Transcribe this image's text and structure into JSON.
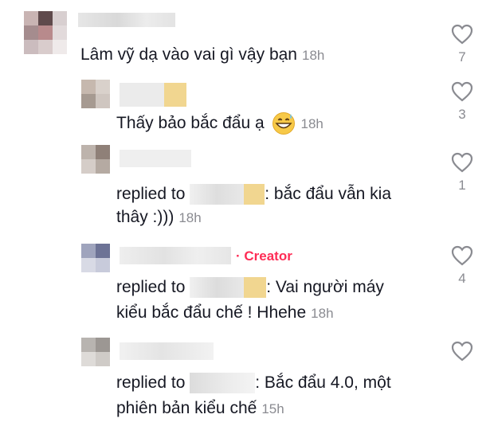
{
  "comments": [
    {
      "text": "Lâm vỹ dạ vào vai gì vậy bạn",
      "time": "18h",
      "likes": "7"
    },
    {
      "text": "Thấy bảo bắc đẩu ạ",
      "time": "18h",
      "likes": "3",
      "emoji": "grinning-sweat-emoji"
    },
    {
      "replied_prefix": "replied to",
      "text_line1": ": bắc đẩu vẫn kia",
      "text_line2": "thây :)))",
      "time": "18h",
      "likes": "1"
    },
    {
      "badge": "· Creator",
      "replied_prefix": "replied to",
      "text_line1": ": Vai người máy",
      "text_line2": "kiểu bắc đẩu chế ! Hhehe",
      "time": "18h",
      "likes": "4"
    },
    {
      "replied_prefix": "replied to",
      "text_line1": ": Bắc đẩu 4.0, một",
      "text_line2": "phiên bản kiểu chế",
      "time": "15h",
      "likes": ""
    }
  ],
  "colors": {
    "accent": "#fe2c55",
    "text": "#161823",
    "muted": "#8a8b91"
  }
}
